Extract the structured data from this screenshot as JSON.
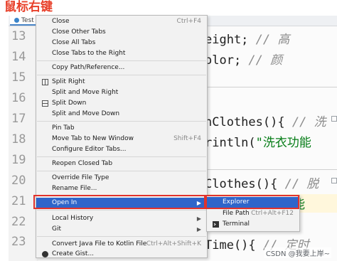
{
  "caption": "鼠标右键",
  "editor": {
    "tab_label": "Test",
    "line_numbers": [
      "13",
      "14",
      "15",
      "16",
      "17",
      "18",
      "19",
      "20",
      "21",
      "22",
      "23"
    ],
    "code": {
      "l13a": "eight; ",
      "l13b": "// 高",
      "l14a": "olor; ",
      "l14b": "// 颜",
      "l17a": "nClothes(){ ",
      "l17b": "// 洗",
      "l18a": "rintln(",
      "l18b": "\"洗衣功能",
      "l20a": "Clothes(){ ",
      "l20b": "// 脱",
      "l21b": "能",
      "l23a": "Time(){ ",
      "l23b": "// 定时"
    }
  },
  "context_menu": {
    "items": [
      {
        "label": "Close",
        "shortcut": "Ctrl+F4"
      },
      {
        "label": "Close Other Tabs"
      },
      {
        "label": "Close All Tabs"
      },
      {
        "label": "Close Tabs to the Right"
      },
      {
        "label": "Copy Path/Reference..."
      },
      {
        "label": "Split Right"
      },
      {
        "label": "Split and Move Right"
      },
      {
        "label": "Split Down"
      },
      {
        "label": "Split and Move Down"
      },
      {
        "label": "Pin Tab"
      },
      {
        "label": "Move Tab to New Window",
        "shortcut": "Shift+F4"
      },
      {
        "label": "Configure Editor Tabs..."
      },
      {
        "label": "Reopen Closed Tab"
      },
      {
        "label": "Override File Type"
      },
      {
        "label": "Rename File..."
      },
      {
        "label": "Open In"
      },
      {
        "label": "Local History"
      },
      {
        "label": "Git"
      },
      {
        "label": "Convert Java File to Kotlin File",
        "shortcut": "Ctrl+Alt+Shift+K"
      },
      {
        "label": "Create Gist..."
      }
    ]
  },
  "submenu": {
    "items": [
      {
        "label": "Explorer"
      },
      {
        "label": "File Path",
        "shortcut": "Ctrl+Alt+F12"
      },
      {
        "label": "Terminal"
      }
    ]
  },
  "watermark": "CSDN @我要上岸~"
}
